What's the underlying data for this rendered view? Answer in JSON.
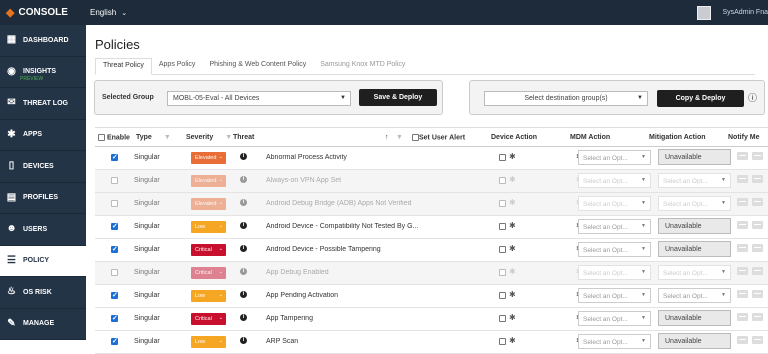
{
  "topbar": {
    "logo": "CONSOLE",
    "language": "English",
    "user": "SysAdmin Fna"
  },
  "sidebar": {
    "items": [
      {
        "label": "DASHBOARD",
        "icon": "dashboard-icon"
      },
      {
        "label": "INSIGHTS",
        "sub": "PREVIEW",
        "icon": "eye-icon"
      },
      {
        "label": "THREAT LOG",
        "icon": "megaphone-icon"
      },
      {
        "label": "APPS",
        "icon": "gear-icon"
      },
      {
        "label": "DEVICES",
        "icon": "phone-icon"
      },
      {
        "label": "PROFILES",
        "icon": "profile-icon"
      },
      {
        "label": "USERS",
        "icon": "users-icon"
      },
      {
        "label": "POLICY",
        "icon": "list-icon"
      },
      {
        "label": "OS RISK",
        "icon": "flame-icon"
      },
      {
        "label": "MANAGE",
        "icon": "wrench-icon"
      }
    ]
  },
  "page": {
    "title": "Policies"
  },
  "tabs": [
    "Threat Policy",
    "Apps Policy",
    "Phishing & Web Content Policy",
    "Samsung Knox MTD Policy"
  ],
  "group": {
    "label": "Selected Group",
    "value": "MOBL-05-Eval - All Devices",
    "deploy": "Save & Deploy"
  },
  "copy": {
    "placeholder": "Select destination group(s)",
    "button": "Copy & Deploy"
  },
  "table": {
    "headers": {
      "enable": "Enable",
      "type": "Type",
      "severity": "Severity",
      "threat": "Threat",
      "alert": "Set User Alert",
      "device": "Device Action",
      "mdm": "MDM Action",
      "mitigation": "Mitigation Action",
      "notify": "Notify Me"
    },
    "mdm_placeholder": "Select an Opt...",
    "rows": [
      {
        "enabled": true,
        "type": "Singular",
        "severity": "Elevated",
        "threat": "Abnormal Process Activity",
        "mitigation": "Unavailable"
      },
      {
        "enabled": false,
        "type": "Singular",
        "severity": "Elevated",
        "threat": "Always-on VPN App Set",
        "mitigation": "Select an Opt..."
      },
      {
        "enabled": false,
        "type": "Singular",
        "severity": "Elevated",
        "threat": "Android Debug Bridge (ADB) Apps Not Verified",
        "mitigation": "Select an Opt..."
      },
      {
        "enabled": true,
        "type": "Singular",
        "severity": "Low",
        "threat": "Android Device - Compatibility Not Tested By G...",
        "mitigation": "Unavailable"
      },
      {
        "enabled": true,
        "type": "Singular",
        "severity": "Critical",
        "threat": "Android Device - Possible Tampering",
        "mitigation": "Unavailable"
      },
      {
        "enabled": false,
        "type": "Singular",
        "severity": "Critical",
        "threat": "App Debug Enabled",
        "mitigation": "Select an Opt..."
      },
      {
        "enabled": true,
        "type": "Singular",
        "severity": "Low",
        "threat": "App Pending Activation",
        "mitigation": "Select an Opt..."
      },
      {
        "enabled": true,
        "type": "Singular",
        "severity": "Critical",
        "threat": "App Tampering",
        "mitigation": "Unavailable"
      },
      {
        "enabled": true,
        "type": "Singular",
        "severity": "Low",
        "threat": "ARP Scan",
        "mitigation": "Unavailable"
      }
    ]
  }
}
